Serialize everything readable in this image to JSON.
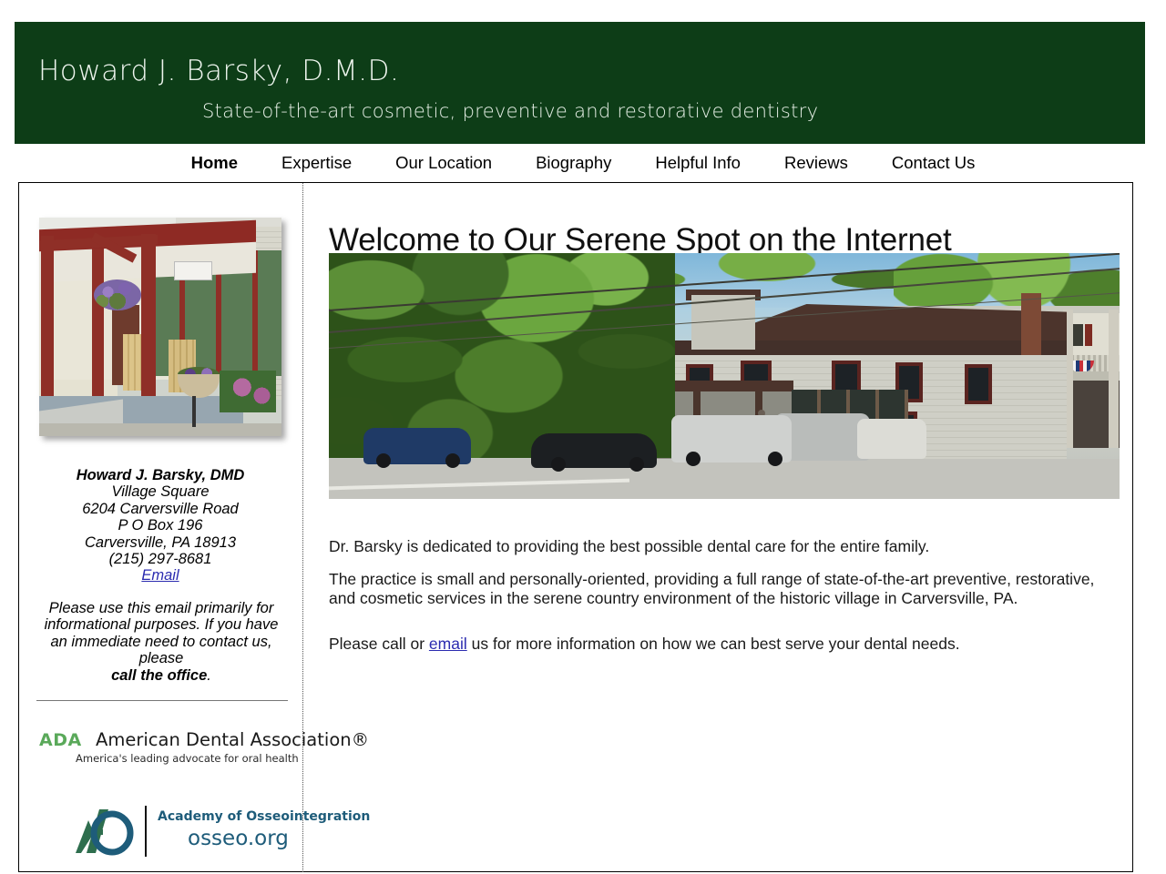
{
  "banner": {
    "practice_name": "Howard J. Barsky, D.M.D.",
    "tagline": "State-of-the-art cosmetic, preventive and restorative dentistry",
    "background_color": "#0d3d17",
    "text_color": "#eef5ee"
  },
  "nav": {
    "items": [
      {
        "label": "Home",
        "active": true
      },
      {
        "label": "Expertise",
        "active": false
      },
      {
        "label": "Our Location",
        "active": false
      },
      {
        "label": "Biography",
        "active": false
      },
      {
        "label": "Helpful Info",
        "active": false
      },
      {
        "label": "Reviews",
        "active": false
      },
      {
        "label": "Contact Us",
        "active": false
      }
    ]
  },
  "sidebar": {
    "office_photo_alt": "office-porch-photo",
    "address": {
      "name": "Howard J. Barsky, DMD",
      "line1": "Village Square",
      "line2": "6204 Carversville Road",
      "line3": "P O Box 196",
      "line4": "Carversville, PA 18913",
      "phone": "(215) 297-8681",
      "email_link_label": "Email"
    },
    "disclaimer": {
      "text": "Please use this email primarily for informational purposes. If you have an immediate need to contact us, please",
      "emphasis": "call the office",
      "period": "."
    },
    "ada_logo": {
      "mark": "ADA",
      "name": "American Dental Association®",
      "tagline": "America's leading advocate for oral health",
      "mark_color": "#5aa95a"
    },
    "ao_logo": {
      "name": "Academy of Osseointegration",
      "url": "osseo.org",
      "color": "#1e5c7a"
    }
  },
  "main": {
    "title": "Welcome to Our Serene Spot on the Internet",
    "hero_photo_alt": "carversville-village-street-photo",
    "paragraph1": "Dr. Barsky is dedicated to providing the best possible dental care for the entire family.",
    "paragraph2": "The practice is small and personally-oriented, providing a full range of state-of-the-art preventive, restorative, and cosmetic services in the serene country environment of the historic village in Carversville, PA.",
    "paragraph3_before": "Please call or ",
    "paragraph3_link": "email",
    "paragraph3_after": " us for more information on how we can best serve your dental needs."
  }
}
